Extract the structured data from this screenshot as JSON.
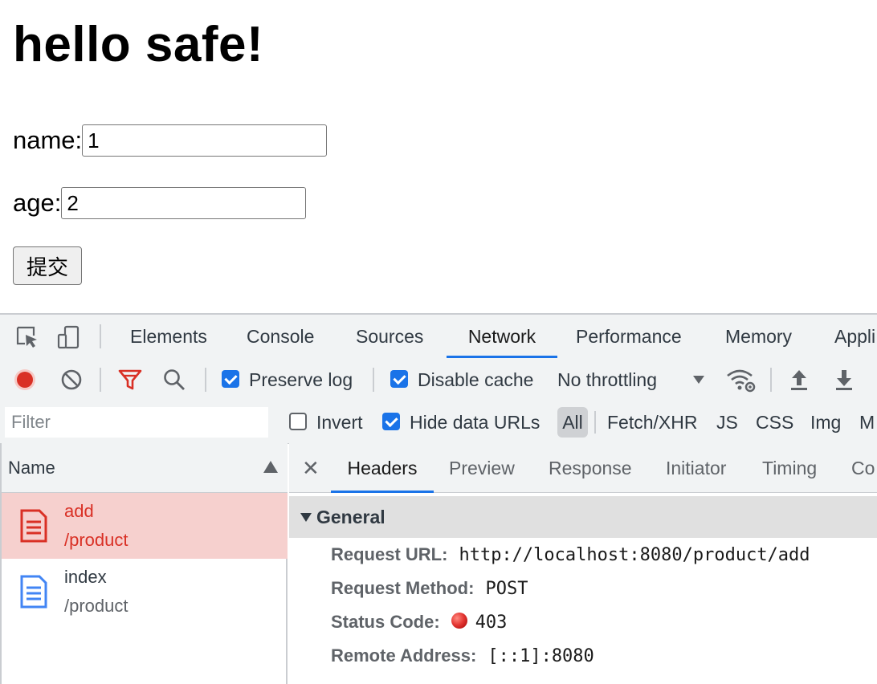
{
  "page": {
    "heading": "hello safe!",
    "name_label": "name:",
    "name_value": "1",
    "age_label": "age:",
    "age_value": "2",
    "submit_label": "提交"
  },
  "devtools": {
    "tabs": [
      "Elements",
      "Console",
      "Sources",
      "Network",
      "Performance",
      "Memory",
      "Appli"
    ],
    "active_tab": "Network",
    "toolbar": {
      "preserve_log_label": "Preserve log",
      "preserve_log_checked": true,
      "disable_cache_label": "Disable cache",
      "disable_cache_checked": true,
      "throttling": "No throttling"
    },
    "filterbar": {
      "filter_placeholder": "Filter",
      "invert_label": "Invert",
      "invert_checked": false,
      "hide_data_urls_label": "Hide data URLs",
      "hide_data_urls_checked": true,
      "types": [
        "All",
        "Fetch/XHR",
        "JS",
        "CSS",
        "Img",
        "M"
      ]
    },
    "name_column": {
      "header": "Name",
      "requests": [
        {
          "name": "add",
          "path": "/product",
          "selected": true,
          "status": "error"
        },
        {
          "name": "index",
          "path": "/product",
          "selected": false,
          "status": "ok"
        }
      ]
    },
    "detail": {
      "tabs": [
        "Headers",
        "Preview",
        "Response",
        "Initiator",
        "Timing",
        "Co"
      ],
      "active_tab": "Headers",
      "section": "General",
      "fields": [
        {
          "key": "Request URL:",
          "value": "http://localhost:8080/product/add"
        },
        {
          "key": "Request Method:",
          "value": "POST"
        },
        {
          "key": "Status Code:",
          "value": "403"
        },
        {
          "key": "Remote Address:",
          "value": "[::1]:8080"
        }
      ]
    },
    "colors": {
      "accent": "#1a73e8",
      "record": "#d93025",
      "selected_row": "#f6d0ce",
      "doc_icon_blue": "#4285f4"
    }
  }
}
